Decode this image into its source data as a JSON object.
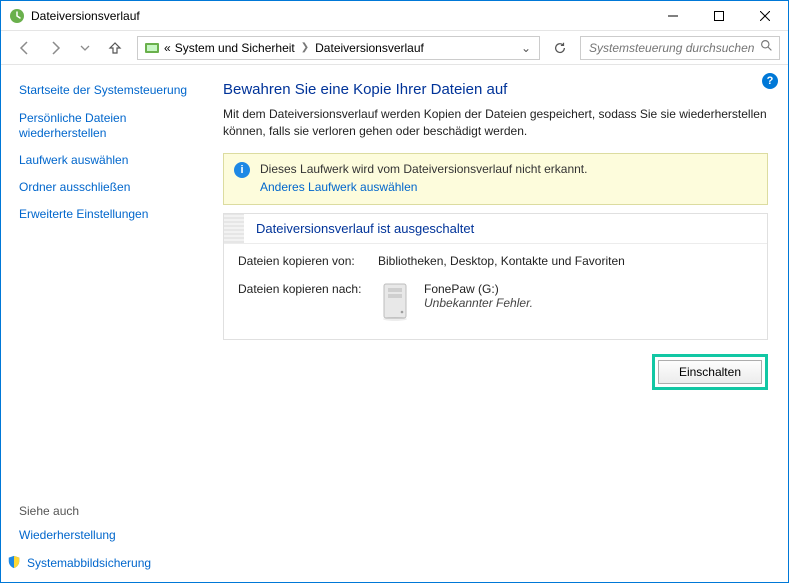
{
  "titlebar": {
    "title": "Dateiversionsverlauf"
  },
  "breadcrumb": {
    "prefix": "«",
    "part1": "System und Sicherheit",
    "part2": "Dateiversionsverlauf"
  },
  "search": {
    "placeholder": "Systemsteuerung durchsuchen"
  },
  "sidebar": {
    "heading": "Startseite der Systemsteuerung",
    "links": {
      "l0": "Persönliche Dateien wiederherstellen",
      "l1": "Laufwerk auswählen",
      "l2": "Ordner ausschließen",
      "l3": "Erweiterte Einstellungen"
    },
    "seealso": "Siehe auch",
    "seealso_links": {
      "s0": "Wiederherstellung",
      "s1": "Systemabbildsicherung"
    }
  },
  "main": {
    "title": "Bewahren Sie eine Kopie Ihrer Dateien auf",
    "desc": "Mit dem Dateiversionsverlauf werden Kopien der Dateien gespeichert, sodass Sie sie wiederherstellen können, falls sie verloren gehen oder beschädigt werden.",
    "notice": {
      "msg": "Dieses Laufwerk wird vom Dateiversionsverlauf nicht erkannt.",
      "link": "Anderes Laufwerk auswählen"
    },
    "status": {
      "heading": "Dateiversionsverlauf ist ausgeschaltet",
      "copy_from_label": "Dateien kopieren von:",
      "copy_from_value": "Bibliotheken, Desktop, Kontakte und Favoriten",
      "copy_to_label": "Dateien kopieren nach:",
      "copy_to_drive": "FonePaw (G:)",
      "copy_to_error": "Unbekannter Fehler."
    },
    "button": "Einschalten"
  }
}
